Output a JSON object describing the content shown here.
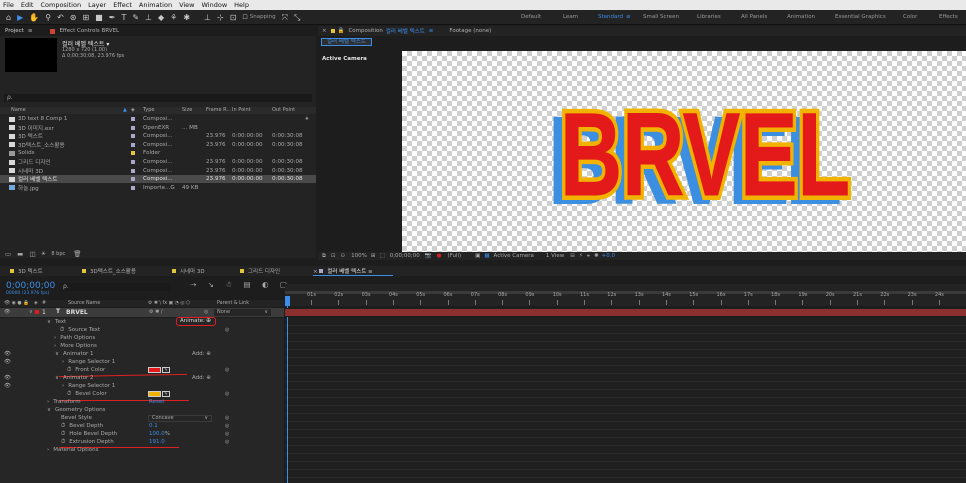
{
  "menu": [
    "File",
    "Edit",
    "Composition",
    "Layer",
    "Effect",
    "Animation",
    "View",
    "Window",
    "Help"
  ],
  "toolbar": {
    "snapping_label": "Snapping"
  },
  "workspaces": [
    "Default",
    "Learn",
    "Standard",
    "Small Screen",
    "Libraries",
    "All Panels",
    "Animation",
    "Essential Graphics",
    "Color",
    "Effects"
  ],
  "workspace_active": "Standard",
  "project": {
    "tab": "Project",
    "effect_controls_tab": "Effect Controls BRVEL",
    "selected_name": "컬러 베벨 텍스트 ▾",
    "selected_info1": "1280 x 720 (1.00)",
    "selected_info2": "Δ 0;00;30;08, 23.976 fps",
    "search_placeholder": "ρ.",
    "columns": [
      "Name",
      "Type",
      "Size",
      "Frame R...",
      "In Point",
      "Out Point"
    ],
    "items": [
      {
        "name": "3D text 8 Comp 1",
        "type": "Composi...",
        "size": "",
        "fr": "",
        "in": "",
        "out": "",
        "color": "#a8a8c8"
      },
      {
        "name": "3D 이미지.exr",
        "type": "OpenEXR",
        "size": "... MB",
        "fr": "",
        "in": "",
        "out": "",
        "color": "#a8a8c8"
      },
      {
        "name": "3D 텍스트",
        "type": "Composi...",
        "size": "",
        "fr": "23.976",
        "in": "0:00:00:00",
        "out": "0:00:30:08",
        "color": "#a8a8c8"
      },
      {
        "name": "3D텍스트_소스활용",
        "type": "Composi...",
        "size": "",
        "fr": "23.976",
        "in": "0:00:00:00",
        "out": "0:00:30:08",
        "color": "#a8a8c8"
      },
      {
        "name": "Solids",
        "type": "Folder",
        "size": "",
        "fr": "",
        "in": "",
        "out": "",
        "color": "#e4c53a"
      },
      {
        "name": "그리드 디자인",
        "type": "Composi...",
        "size": "",
        "fr": "23.976",
        "in": "0:00:00:00",
        "out": "0:00:30:08",
        "color": "#a8a8c8"
      },
      {
        "name": "시네마 3D",
        "type": "Composi...",
        "size": "",
        "fr": "23.976",
        "in": "0:00:00:00",
        "out": "0:00:30:08",
        "color": "#a8a8c8"
      },
      {
        "name": "컬러 베벨 텍스트",
        "type": "Composi...",
        "size": "",
        "fr": "23.976",
        "in": "0:00:00:00",
        "out": "0:00:30:08",
        "color": "#a8a8c8"
      },
      {
        "name": "하늘.jpg",
        "type": "Importe...G",
        "size": "49 KB",
        "fr": "",
        "in": "",
        "out": "",
        "color": "#a8a8c8"
      }
    ],
    "bpc": "8 bpc"
  },
  "comp": {
    "tab_prefix": "Composition",
    "tab_name": "컬러 베벨 텍스트",
    "footage_tab": "Footage (none)",
    "sub_tab": "컬러 베벨 텍스트",
    "camera_label": "Active Camera",
    "text": "BRVEL",
    "zoom": "100%",
    "time": "0;00;00;00",
    "quality": "(Full)",
    "camera_menu": "Active Camera",
    "view_menu": "1 View",
    "offset": "+0.0"
  },
  "timeline": {
    "tabs": [
      "3D 텍스트",
      "3D텍스트_소스활용",
      "시네마 3D",
      "그리드 디자인",
      "컬러 베벨 텍스트"
    ],
    "current_time": "0;00;00;00",
    "frame_info": "00000 (23.976 fps)",
    "col_source": "Source Name",
    "col_parent": "Parent & Link",
    "layer_num": "1",
    "layer_name": "BRVEL",
    "parent_value": "None",
    "animate_label": "Animate:",
    "add_label": "Add:",
    "ticks": [
      "01s",
      "02s",
      "03s",
      "04s",
      "05s",
      "06s",
      "07s",
      "08s",
      "09s",
      "10s",
      "11s",
      "12s",
      "13s",
      "14s",
      "15s",
      "16s",
      "17s",
      "18s",
      "19s",
      "20s",
      "21s",
      "22s",
      "23s",
      "24s"
    ],
    "props": {
      "text": "Text",
      "source_text": "Source Text",
      "path_options": "Path Options",
      "more_options": "More Options",
      "animator1": "Animator 1",
      "range1": "Range Selector 1",
      "front_color": "Front Color",
      "animator2": "Animator 2",
      "range2": "Range Selector 1",
      "bevel_color": "Bevel Color",
      "transform": "Transform",
      "reset": "Reset",
      "geometry": "Geometry Options",
      "bevel_style": "Bevel Style",
      "bevel_style_value": "Concave",
      "bevel_depth": "Bevel Depth",
      "bevel_depth_value": "0.1",
      "hole_bevel": "Hole Bevel Depth",
      "hole_bevel_value": "100.0",
      "hole_bevel_unit": "%",
      "extrusion": "Extrusion Depth",
      "extrusion_value": "191.0",
      "material": "Material Options"
    }
  },
  "colors": {
    "front": "#e41a1a",
    "bevel": "#f2b200",
    "accent": "#3d8ee8",
    "layer_bar": "#8b2f2f"
  }
}
